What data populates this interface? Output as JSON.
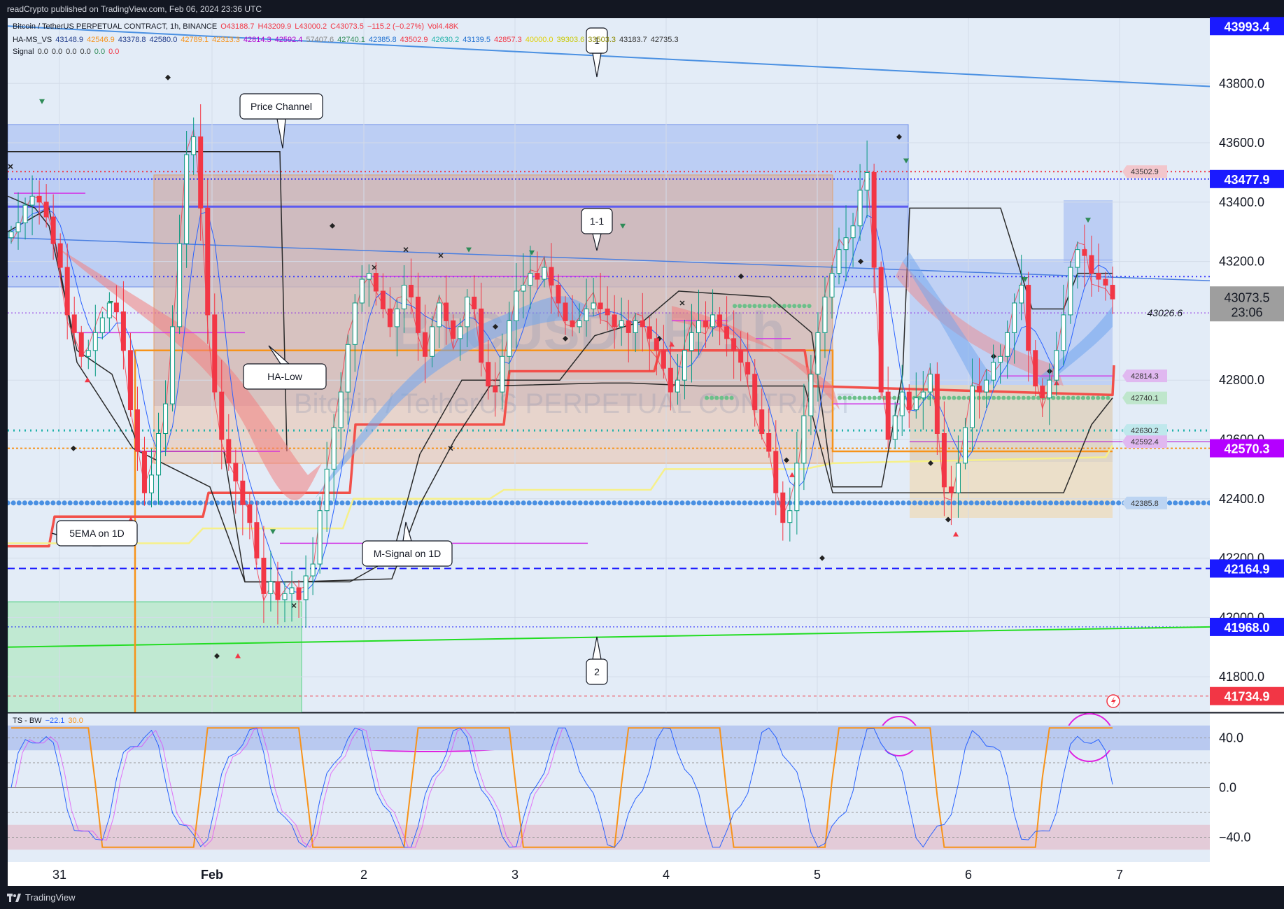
{
  "header": {
    "published": "readCrypto published on TradingView.com, Feb 06, 2024 23:36 UTC"
  },
  "legend": {
    "line1": [
      {
        "t": "Bitcoin / TetherUS PERPETUAL CONTRACT, 1h, BINANCE",
        "c": "#131722"
      },
      {
        "t": "O43188.7",
        "c": "#f23645"
      },
      {
        "t": "H43209.9",
        "c": "#f23645"
      },
      {
        "t": "L43000.2",
        "c": "#f23645"
      },
      {
        "t": "C43073.5",
        "c": "#f23645"
      },
      {
        "t": "−115.2 (−0.27%)",
        "c": "#f23645"
      },
      {
        "t": "Vol4.48K",
        "c": "#f23645"
      }
    ],
    "line2": [
      {
        "t": "HA-MS_VS",
        "c": "#131722"
      },
      {
        "t": "43148.9",
        "c": "#1e3a8a"
      },
      {
        "t": "42546.9",
        "c": "#f7931a"
      },
      {
        "t": "43378.8",
        "c": "#1e3a8a"
      },
      {
        "t": "42580.0",
        "c": "#1e3a8a"
      },
      {
        "t": "42789.1",
        "c": "#f7931a"
      },
      {
        "t": "42313.3",
        "c": "#f7931a"
      },
      {
        "t": "42814.3",
        "c": "#b000d0"
      },
      {
        "t": "42592.4",
        "c": "#b000d0"
      },
      {
        "t": "57407.6",
        "c": "#888888"
      },
      {
        "t": "42740.1",
        "c": "#2e8b57"
      },
      {
        "t": "42385.8",
        "c": "#1e6fd0"
      },
      {
        "t": "43502.9",
        "c": "#f23645"
      },
      {
        "t": "42630.2",
        "c": "#20b2aa"
      },
      {
        "t": "43139.5",
        "c": "#1e6fd0"
      },
      {
        "t": "42857.3",
        "c": "#f23645"
      },
      {
        "t": "40000.0",
        "c": "#e0d000"
      },
      {
        "t": "39303.6",
        "c": "#c8c800"
      },
      {
        "t": "33503.3",
        "c": "#8a8a00"
      },
      {
        "t": "43183.7",
        "c": "#333333"
      },
      {
        "t": "42735.3",
        "c": "#333333"
      }
    ],
    "line3": [
      {
        "t": "Signal",
        "c": "#131722"
      },
      {
        "t": "0.0",
        "c": "#333333"
      },
      {
        "t": "0.0",
        "c": "#333333"
      },
      {
        "t": "0.0",
        "c": "#333333"
      },
      {
        "t": "0.0",
        "c": "#333333"
      },
      {
        "t": "0.0",
        "c": "#2e8b57"
      },
      {
        "t": "0.0",
        "c": "#f23645"
      }
    ],
    "osc": [
      {
        "t": "TS - BW",
        "c": "#131722"
      },
      {
        "t": "−22.1",
        "c": "#2962ff"
      },
      {
        "t": "30.0",
        "c": "#f7931a"
      }
    ]
  },
  "watermark": {
    "ticker": "BTCUSDT.P, 1h",
    "name": "Bitcoin / TetherUS PERPETUAL CONTRACT"
  },
  "labels": {
    "price_channel": "Price Channel",
    "ha_low": "HA-Low",
    "ema5": "5EMA on 1D",
    "msignal": "M-Signal on 1D",
    "one_one": "1-1",
    "one": "1",
    "two": "2",
    "last_tag_price": "43026.6"
  },
  "chart_data": {
    "type": "candlestick",
    "y_ticks": [
      "43800.0",
      "43600.0",
      "43400.0",
      "43200.0",
      "42800.0",
      "42600.0",
      "42400.0",
      "42200.0",
      "42000.0",
      "41800.0"
    ],
    "x_ticks": [
      "31",
      "Feb",
      "2",
      "3",
      "4",
      "5",
      "6",
      "7"
    ],
    "ylim": [
      41680,
      44020
    ],
    "price_tags": [
      {
        "value": 43993.4,
        "label": "43993.4",
        "bg": "#1a1aff",
        "fg": "#ffffff"
      },
      {
        "value": 43477.9,
        "label": "43477.9",
        "bg": "#1a1aff",
        "fg": "#ffffff"
      },
      {
        "value": 42570.3,
        "label": "42570.3",
        "bg": "#b400ff",
        "fg": "#ffffff"
      },
      {
        "value": 42164.9,
        "label": "42164.9",
        "bg": "#1a1aff",
        "fg": "#ffffff"
      },
      {
        "value": 41968.0,
        "label": "41968.0",
        "bg": "#1a1aff",
        "fg": "#ffffff"
      },
      {
        "value": 41734.9,
        "label": "41734.9",
        "bg": "#f23645",
        "fg": "#ffffff"
      }
    ],
    "current_price": {
      "value": 43073.5,
      "label": "43073.5",
      "countdown": "23:06"
    },
    "level_tags": [
      {
        "value": 43502.9,
        "label": "43502.9",
        "bg": "#f2c6cc"
      },
      {
        "value": 42814.3,
        "label": "42814.3",
        "bg": "#e0b8f0"
      },
      {
        "value": 42740.1,
        "label": "42740.1",
        "bg": "#bfe6cc"
      },
      {
        "value": 42630.2,
        "label": "42630.2",
        "bg": "#bfe8ec"
      },
      {
        "value": 42592.4,
        "label": "42592.4",
        "bg": "#e0b8f0"
      },
      {
        "value": 42385.8,
        "label": "42385.8",
        "bg": "#bcd4f2"
      }
    ],
    "close_series": [
      43300,
      43330,
      43390,
      43420,
      43400,
      43350,
      43260,
      43180,
      43020,
      42960,
      42880,
      42900,
      42960,
      43010,
      43060,
      43030,
      42900,
      42700,
      42560,
      42420,
      42480,
      42620,
      42720,
      42980,
      43260,
      43560,
      43620,
      43380,
      43020,
      42760,
      42600,
      42520,
      42460,
      42380,
      42320,
      42200,
      42080,
      42120,
      42060,
      42080,
      42100,
      42060,
      42140,
      42180,
      42360,
      42500,
      42640,
      42760,
      42920,
      43060,
      43140,
      43160,
      43100,
      43040,
      42980,
      43040,
      43120,
      43080,
      42960,
      42880,
      42980,
      43060,
      43000,
      42940,
      42980,
      43080,
      43040,
      42860,
      42780,
      42760,
      42880,
      43000,
      43100,
      43120,
      43160,
      43140,
      43180,
      43120,
      43060,
      43000,
      42980,
      43000,
      43040,
      43060,
      43040,
      43020,
      42980,
      43000,
      42960,
      43000,
      42980,
      42940,
      42900,
      42840,
      42760,
      42800,
      42900,
      42960,
      43000,
      42980,
      43020,
      42980,
      42940,
      42900,
      42860,
      42820,
      42700,
      42620,
      42560,
      42420,
      42320,
      42360,
      42520,
      42680,
      42820,
      42960,
      43080,
      43160,
      43240,
      43280,
      43320,
      43440,
      43500,
      43180,
      42760,
      42600,
      42680,
      42760,
      42700,
      42740,
      42760,
      42820,
      42620,
      42440,
      42420,
      42520,
      42640,
      42780,
      42760,
      42800,
      42860,
      42880,
      42960,
      43060,
      43120,
      42900,
      42780,
      42740,
      42800,
      42900,
      43020,
      43180,
      43240,
      43220,
      43160,
      43140,
      43120,
      43073.5
    ],
    "oscillator": {
      "y_ticks": [
        "40.0",
        "0.0",
        "−40.0"
      ],
      "ylim": [
        -60,
        60
      ],
      "bands": {
        "upper": [
          30,
          50
        ],
        "lower": [
          -50,
          -30
        ],
        "lines": [
          40,
          20,
          0,
          -20,
          -40
        ]
      }
    }
  },
  "colors": {
    "bull": "#089981",
    "bear": "#f23645",
    "chart_bg": "#e3ecf7"
  }
}
